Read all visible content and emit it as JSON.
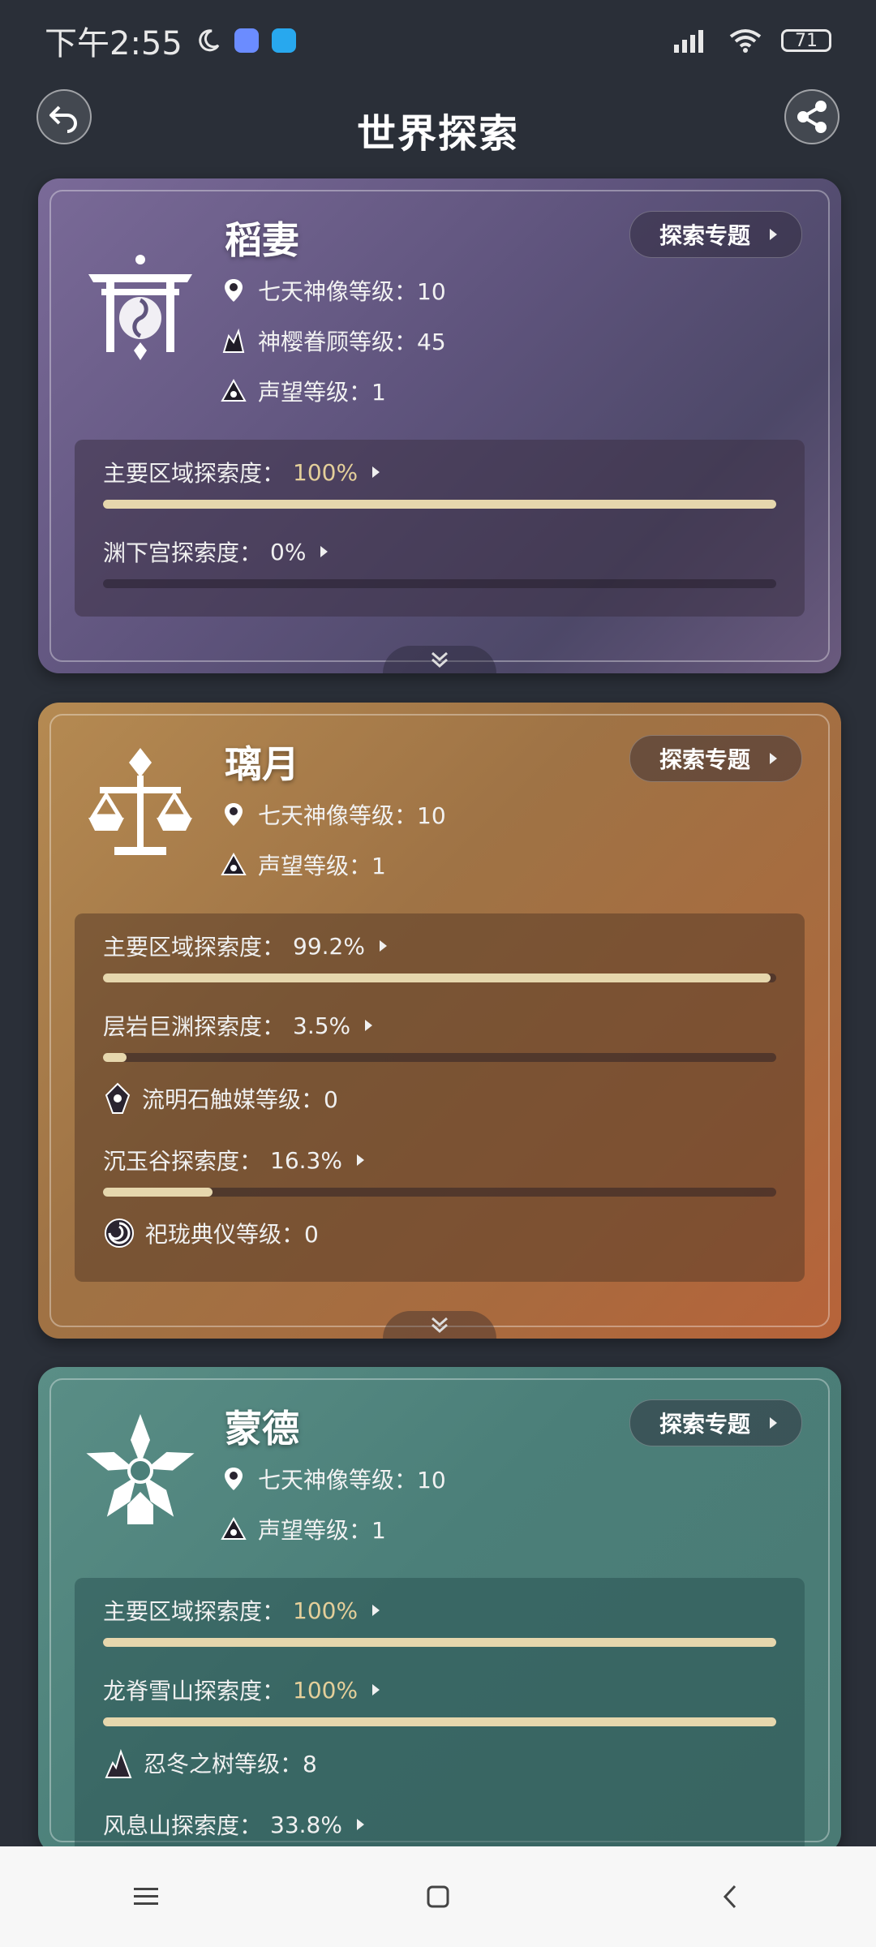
{
  "status_bar": {
    "time": "下午2:55",
    "battery": "71"
  },
  "header": {
    "title": "世界探索"
  },
  "regions": [
    {
      "name": "稻妻",
      "topic_label": "探索专题",
      "stats": [
        {
          "label": "七天神像等级：10"
        },
        {
          "label": "神樱眷顾等级：45"
        },
        {
          "label": "声望等级：1"
        }
      ],
      "progress": [
        {
          "label": "主要区域探索度：",
          "value": "100%",
          "fraction": 1.0
        },
        {
          "label": "渊下宫探索度：",
          "value": "0%",
          "fraction": 0.0
        }
      ]
    },
    {
      "name": "璃月",
      "topic_label": "探索专题",
      "stats": [
        {
          "label": "七天神像等级：10"
        },
        {
          "label": "声望等级：1"
        }
      ],
      "progress": [
        {
          "label": "主要区域探索度：",
          "value": "99.2%",
          "fraction": 0.992
        },
        {
          "label": "层岩巨渊探索度：",
          "value": "3.5%",
          "fraction": 0.035
        },
        {
          "label": "沉玉谷探索度：",
          "value": "16.3%",
          "fraction": 0.163
        }
      ],
      "levels": [
        {
          "label": "流明石触媒等级：0"
        },
        {
          "label": "祀珑典仪等级：0"
        }
      ]
    },
    {
      "name": "蒙德",
      "topic_label": "探索专题",
      "stats": [
        {
          "label": "七天神像等级：10"
        },
        {
          "label": "声望等级：1"
        }
      ],
      "progress": [
        {
          "label": "主要区域探索度：",
          "value": "100%",
          "fraction": 1.0
        },
        {
          "label": "龙脊雪山探索度：",
          "value": "100%",
          "fraction": 1.0
        },
        {
          "label": "风息山探索度：",
          "value": "33.8%",
          "fraction": 0.338
        }
      ],
      "levels": [
        {
          "label": "忍冬之树等级：8"
        }
      ]
    }
  ],
  "colors": {
    "accent_gold": "#e6d7ad",
    "inazuma_bg": "#5f547d",
    "liyue_bg": "#9f7345",
    "mondstadt_bg": "#4b7f79"
  },
  "icons": {
    "back": "back-arrow-icon",
    "share": "share-icon",
    "statue": "location-pin-icon",
    "reputation": "reputation-icon",
    "sakura": "sacred-sakura-icon"
  }
}
